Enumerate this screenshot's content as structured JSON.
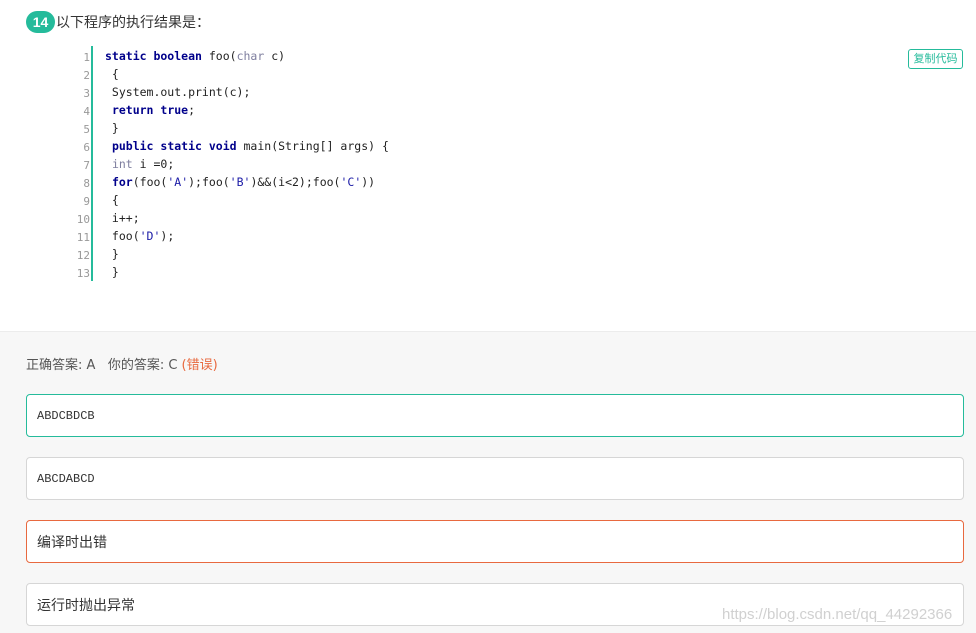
{
  "question": {
    "number": "14",
    "title": "以下程序的执行结果是："
  },
  "code": {
    "copy_label": "复制代码",
    "line_numbers": [
      "1",
      "2",
      "3",
      "4",
      "5",
      "6",
      "7",
      "8",
      "9",
      "10",
      "11",
      "12",
      "13"
    ],
    "lines": [
      [
        {
          "t": "static boolean ",
          "c": "kw"
        },
        {
          "t": "foo(",
          "c": ""
        },
        {
          "t": "char",
          "c": "kwl"
        },
        {
          "t": " c)",
          "c": ""
        }
      ],
      [
        {
          "t": " {",
          "c": ""
        }
      ],
      [
        {
          "t": " System.out.print(c);",
          "c": ""
        }
      ],
      [
        {
          "t": " ",
          "c": ""
        },
        {
          "t": "return true",
          "c": "kw"
        },
        {
          "t": ";",
          "c": ""
        }
      ],
      [
        {
          "t": " }",
          "c": ""
        }
      ],
      [
        {
          "t": " ",
          "c": ""
        },
        {
          "t": "public static void ",
          "c": "kw"
        },
        {
          "t": "main(String[] args) {",
          "c": ""
        }
      ],
      [
        {
          "t": " ",
          "c": ""
        },
        {
          "t": "int",
          "c": "kwl"
        },
        {
          "t": " i =0;",
          "c": ""
        }
      ],
      [
        {
          "t": " ",
          "c": ""
        },
        {
          "t": "for",
          "c": "kw"
        },
        {
          "t": "(foo(",
          "c": ""
        },
        {
          "t": "'A'",
          "c": "str"
        },
        {
          "t": ");foo(",
          "c": ""
        },
        {
          "t": "'B'",
          "c": "str"
        },
        {
          "t": ")&&(i<2);foo(",
          "c": ""
        },
        {
          "t": "'C'",
          "c": "str"
        },
        {
          "t": "))",
          "c": ""
        }
      ],
      [
        {
          "t": " {",
          "c": ""
        }
      ],
      [
        {
          "t": " i++;",
          "c": ""
        }
      ],
      [
        {
          "t": " foo(",
          "c": ""
        },
        {
          "t": "'D'",
          "c": "str"
        },
        {
          "t": ");",
          "c": ""
        }
      ],
      [
        {
          "t": " }",
          "c": ""
        }
      ],
      [
        {
          "t": " }",
          "c": ""
        }
      ]
    ]
  },
  "answer": {
    "correct_label": "正确答案: A",
    "yours_label": "你的答案: C",
    "status": "(错误)"
  },
  "options": [
    {
      "text": "ABDCBDCB",
      "state": "correct",
      "mono": true
    },
    {
      "text": "ABCDABCD",
      "state": "normal",
      "mono": true
    },
    {
      "text": "编译时出错",
      "state": "wrong",
      "mono": false
    },
    {
      "text": "运行时抛出异常",
      "state": "normal",
      "mono": false
    }
  ],
  "watermark": "https://blog.csdn.net/qq_44292366",
  "colors": {
    "accent": "#25bb9b",
    "error": "#e8693f"
  }
}
